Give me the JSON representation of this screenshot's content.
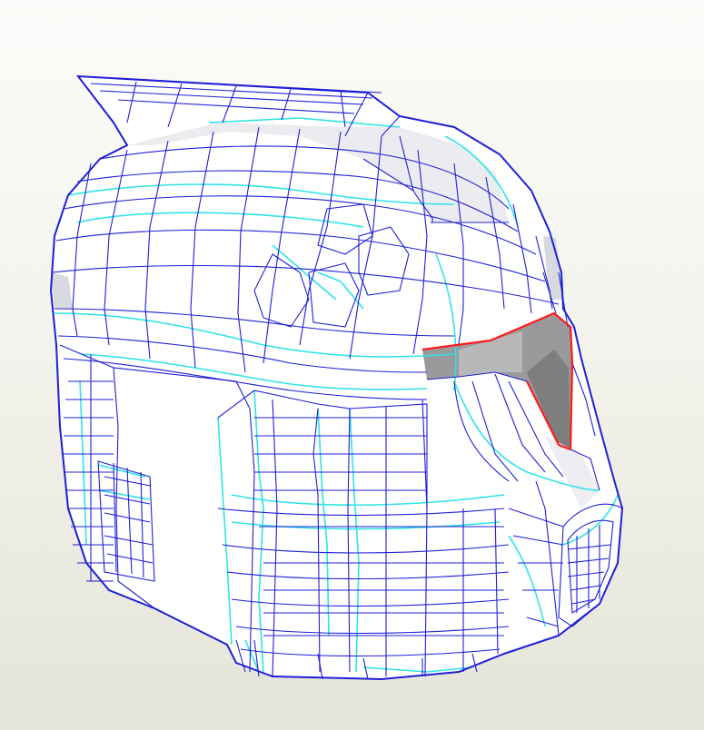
{
  "viewport": {
    "background_top": "#fbfbf9",
    "background_bottom": "#e4e4d8"
  },
  "model": {
    "subject": "helmet-wireframe",
    "colors": {
      "face_fill": "#ffffff",
      "shaded_face": "#e6e6ea",
      "dark_face": "#9a9a9c",
      "edge": "#1f1fd6",
      "seam": "#2fe3e8",
      "cut_edge": "#ff1a1a"
    }
  }
}
